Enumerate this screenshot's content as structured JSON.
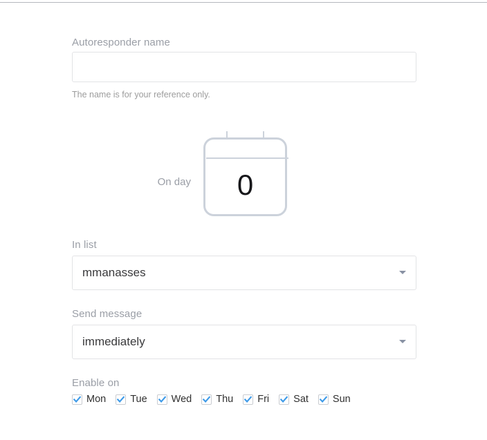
{
  "theme": {
    "label_color": "#9a9ea6",
    "value_color": "#3a3a3c",
    "border_color": "#e2e3e5",
    "calendar_color": "#ccd2db",
    "checkbox_accent": "#3d9ae8",
    "help_color": "#9c9c9c"
  },
  "form": {
    "name_field": {
      "label": "Autoresponder name",
      "value": "",
      "placeholder": "",
      "help": "The name is for your reference only."
    },
    "on_day": {
      "label": "On day",
      "value": "0",
      "icon": "calendar-icon"
    },
    "in_list": {
      "label": "In list",
      "value": "mmanasses",
      "caret_icon": "chevron-down-icon"
    },
    "send_message": {
      "label": "Send message",
      "value": "immediately",
      "caret_icon": "chevron-down-icon"
    },
    "enable_on": {
      "label": "Enable on",
      "days": [
        {
          "label": "Mon",
          "checked": true
        },
        {
          "label": "Tue",
          "checked": true
        },
        {
          "label": "Wed",
          "checked": true
        },
        {
          "label": "Thu",
          "checked": true
        },
        {
          "label": "Fri",
          "checked": true
        },
        {
          "label": "Sat",
          "checked": true
        },
        {
          "label": "Sun",
          "checked": true
        }
      ]
    }
  }
}
